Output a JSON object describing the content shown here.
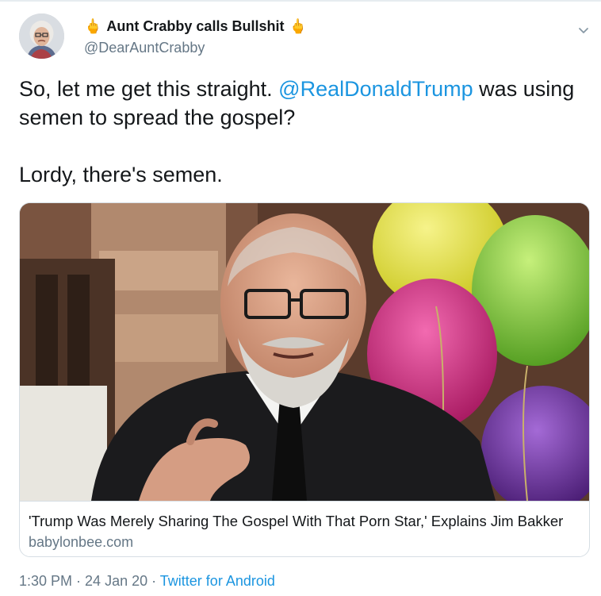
{
  "tweet": {
    "display_name": "Aunt Crabby calls Bullshit",
    "handle": "@DearAuntCrabby",
    "hand_emoji": "🖕",
    "text_line1_prefix": "So, let me get this straight. ",
    "mention": "@RealDonaldTrump",
    "text_line1_suffix": " was using semen to spread the gospel?",
    "text_line2": "Lordy, there's semen."
  },
  "card": {
    "title": "'Trump Was Merely Sharing The Gospel With That Porn Star,' Explains Jim Bakker",
    "domain": "babylonbee.com"
  },
  "footer": {
    "time": "1:30 PM",
    "separator": " · ",
    "date": "24 Jan 20",
    "source": "Twitter for Android"
  },
  "icons": {
    "avatar": "avatar-portrait",
    "menu": "chevron-down-icon"
  },
  "colors": {
    "link": "#1b95e0",
    "secondary_text": "#657786",
    "border": "#d6dee4"
  }
}
